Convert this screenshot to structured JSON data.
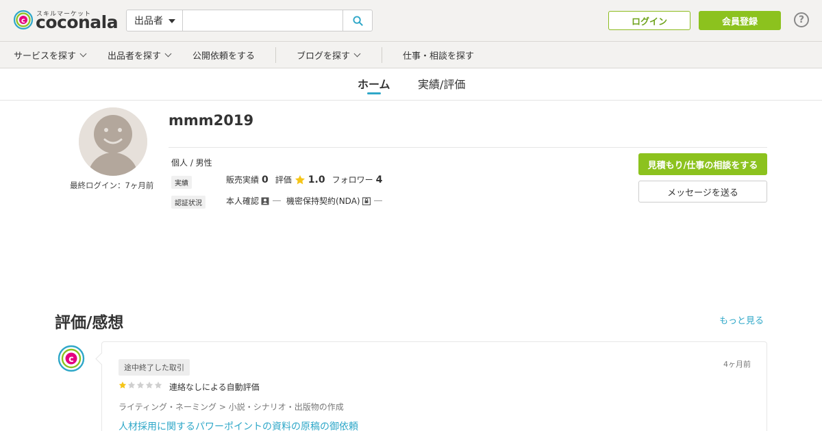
{
  "header": {
    "logo_small": "スキルマーケット",
    "logo_text": "coconala",
    "search": {
      "category": "出品者",
      "value": "",
      "placeholder": ""
    },
    "login_label": "ログイン",
    "register_label": "会員登録",
    "help_label": "?"
  },
  "nav": {
    "items": [
      {
        "label": "サービスを探す",
        "has_dropdown": true
      },
      {
        "label": "出品者を探す",
        "has_dropdown": true
      },
      {
        "label": "公開依頼をする",
        "has_dropdown": false
      },
      {
        "label": "ブログを探す",
        "has_dropdown": true
      },
      {
        "label": "仕事・相談を探す",
        "has_dropdown": false
      }
    ]
  },
  "tabs": [
    {
      "label": "ホーム",
      "active": true
    },
    {
      "label": "実績/評価",
      "active": false
    }
  ],
  "profile": {
    "username": "mmm2019",
    "last_login": "最終ログイン：7ヶ月前",
    "type": "個人 / 男性",
    "achievements_label": "実績",
    "sales_label": "販売実績",
    "sales_value": "0",
    "rating_label": "評価",
    "rating_value": "1.0",
    "followers_label": "フォロワー",
    "followers_value": "4",
    "verification_label": "認証状況",
    "identity_label": "本人確認",
    "nda_label": "機密保持契約(NDA)"
  },
  "actions": {
    "quote_label": "見積もり/仕事の相談をする",
    "message_label": "メッセージを送る"
  },
  "reviews": {
    "title": "評価/感想",
    "more_label": "もっと見る",
    "items": [
      {
        "status": "途中終了した取引",
        "date": "4ヶ月前",
        "stars": 1,
        "text": "連絡なしによる自動評価",
        "category": "ライティング・ネーミング > 小説・シナリオ・出版物の作成",
        "link": "人材採用に関するパワーポイントの資料の原稿の御依頼"
      }
    ]
  },
  "colors": {
    "accent_green": "#8cc21e",
    "link_blue": "#2ea7c8",
    "star_gold": "#f5c518",
    "header_bg": "#f3f2f0"
  }
}
